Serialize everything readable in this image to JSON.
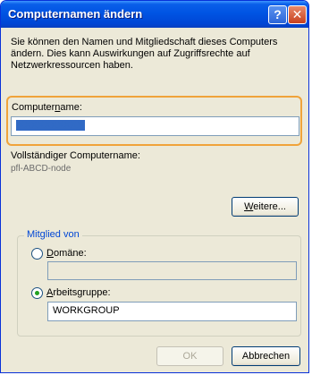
{
  "window": {
    "title": "Computernamen ändern",
    "help_glyph": "?",
    "close_glyph": "✕",
    "title_gradient": "#0054e3",
    "highlight_color": "#f0a33a"
  },
  "intro_text": "Sie können den Namen und Mitgliedschaft dieses Computers ändern. Dies kann Auswirkungen auf Zugriffsrechte auf Netzwerkressourcen haben.",
  "computer_name": {
    "label_pre": "Computer",
    "label_accel": "n",
    "label_post": "ame:",
    "value_obscured": "XXXXXXXXXX"
  },
  "full_name": {
    "label": "Vollständiger Computername:",
    "value_obscured": "pfl-ABCD-node"
  },
  "more_button": {
    "label_accel": "W",
    "label_post": "eitere..."
  },
  "member_group": {
    "legend": "Mitglied von",
    "domain": {
      "label_accel": "D",
      "label_post": "omäne:",
      "value": "",
      "checked": false
    },
    "workgroup": {
      "label_accel": "A",
      "label_post": "rbeitsgruppe:",
      "value": "WORKGROUP",
      "checked": true
    }
  },
  "buttons": {
    "ok": "OK",
    "cancel": "Abbrechen"
  }
}
